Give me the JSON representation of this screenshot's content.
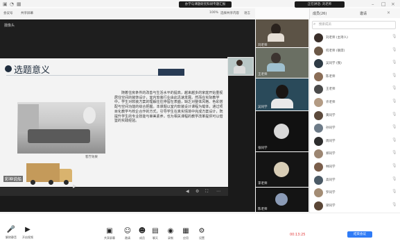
{
  "topbar": {
    "meeting_title": "办学与课题研究科研专题汇报",
    "speaker_label": "正在讲话: 刘老师",
    "window_icons": [
      "minimize-icon",
      "maximize-icon",
      "close-icon"
    ]
  },
  "main_bar": {
    "left_items": [
      "会议号",
      "共享屏幕"
    ],
    "right_items": [
      "100%",
      "选择共享内容",
      "语言"
    ]
  },
  "camera_badge": "摄像头",
  "slide": {
    "title": "选题意义",
    "image_caption": "客厅效果",
    "body": "随着住房条件的改善与生活水平的提高，越来越多的家庭开始重视居住空间的装饰设计，室内软装行业由此迅速发展。然而在实际教学中，学生对软装方案的理解往往停留在表面，缺乏对整体风格、色彩搭配与空间功能的综合把握。本课题以室内软装设计课程为载体，通过项目化教学与校企合作的方式，引导学生在真实情境中完成方案设计，既提升学生的专业技能与审美素养，也为相关课程的教学改革提供可以借鉴的实践经验。",
    "video_label": "彩神说船"
  },
  "video_tiles": [
    {
      "name": "刘老师"
    },
    {
      "name": "王老师"
    },
    {
      "name": "吴同学"
    },
    {
      "name": "张同学"
    },
    {
      "name": "李老师"
    },
    {
      "name": "陈老师"
    },
    {
      "name": "赵老师"
    }
  ],
  "sidebar": {
    "title": "成员(26)",
    "invite_label": "邀请",
    "search_placeholder": "搜索成员",
    "participants": [
      {
        "name": "刘老师 (主持人)"
      },
      {
        "name": "何老师 (联席)"
      },
      {
        "name": "吴同学 (我)"
      },
      {
        "name": "陈老师"
      },
      {
        "name": "王老师"
      },
      {
        "name": "许老师"
      },
      {
        "name": "黄同学"
      },
      {
        "name": "孙同学"
      },
      {
        "name": "周同学"
      },
      {
        "name": "郑同学"
      },
      {
        "name": "林同学"
      },
      {
        "name": "高同学"
      },
      {
        "name": "罗同学"
      },
      {
        "name": "梁同学"
      }
    ]
  },
  "toolbar": {
    "left": [
      {
        "label": "解除静音",
        "icon": "mic-icon"
      },
      {
        "label": "开启视频",
        "icon": "camera-icon"
      }
    ],
    "center": [
      {
        "label": "共享屏幕",
        "icon": "share-screen-icon"
      },
      {
        "label": "邀请",
        "icon": "invite-icon"
      },
      {
        "label": "成员",
        "icon": "members-icon"
      },
      {
        "label": "聊天",
        "icon": "chat-icon"
      },
      {
        "label": "录制",
        "icon": "record-icon"
      },
      {
        "label": "应用",
        "icon": "apps-icon"
      },
      {
        "label": "设置",
        "icon": "settings-icon"
      }
    ],
    "record_time": "00:13:25",
    "end_label": "结束会议"
  },
  "colors": {
    "accent": "#2f7bf6",
    "slide_navy": "#1f2d3d",
    "record_red": "#e23b3b"
  }
}
